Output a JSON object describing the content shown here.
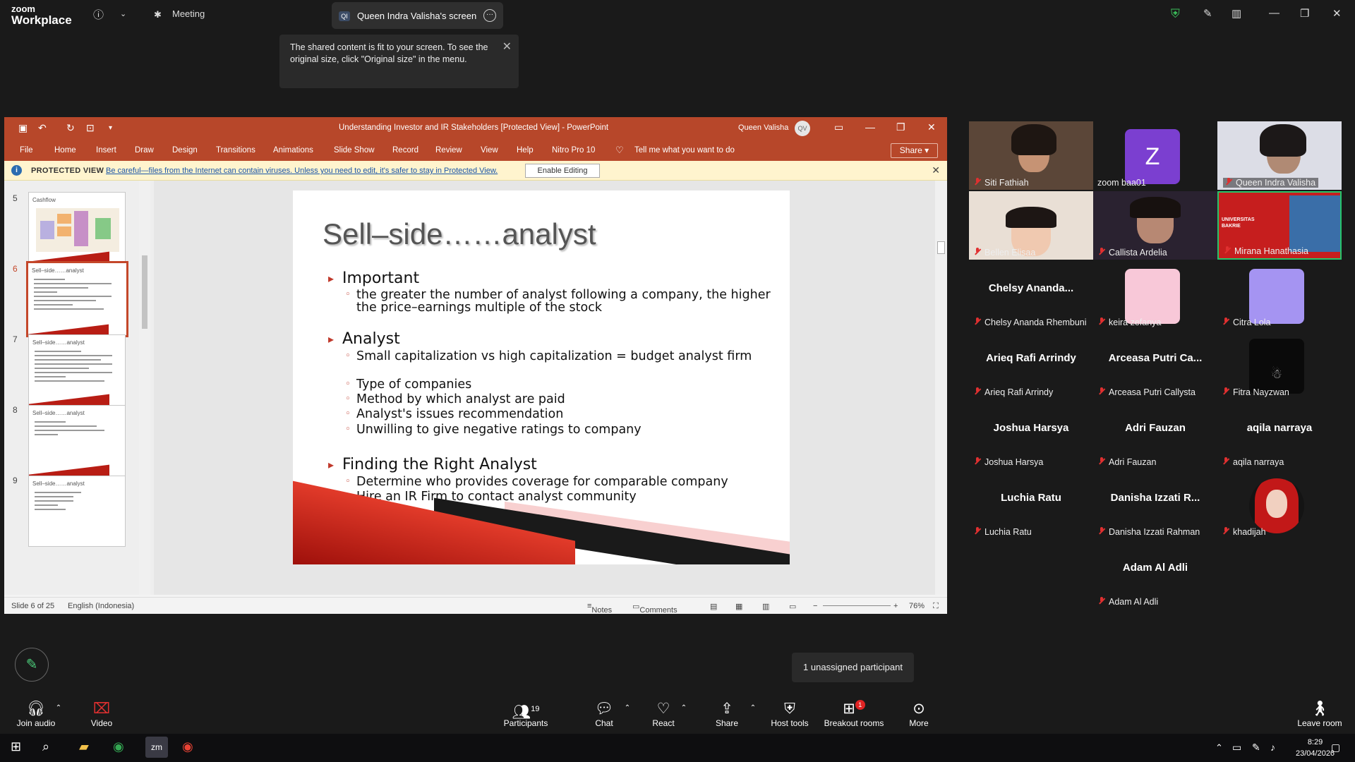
{
  "zoom": {
    "logo_line1": "zoom",
    "logo_line2": "Workplace",
    "meeting_label": "Meeting",
    "screen_tab_initials": "QI",
    "screen_tab_label": "Queen Indra Valisha's screen",
    "tooltip": "The shared content is fit to your screen. To see the original size, click \"Original size\" in the menu.",
    "unassigned": "1 unassigned participant",
    "toolbar": {
      "join_audio": "Join audio",
      "video": "Video",
      "participants": "Participants",
      "participants_count": "19",
      "chat": "Chat",
      "react": "React",
      "share": "Share",
      "host_tools": "Host tools",
      "breakout_rooms": "Breakout rooms",
      "breakout_badge": "1",
      "more": "More",
      "leave_room": "Leave room"
    }
  },
  "ppt": {
    "window_title": "Understanding Investor and IR Stakeholders [Protected View]  -  PowerPoint",
    "user_name": "Queen Valisha",
    "user_initials": "QV",
    "tabs": [
      "File",
      "Home",
      "Insert",
      "Draw",
      "Design",
      "Transitions",
      "Animations",
      "Slide Show",
      "Record",
      "Review",
      "View",
      "Help",
      "Nitro Pro 10"
    ],
    "tell_me": "Tell me what you want to do",
    "share": "Share",
    "protected_label": "PROTECTED VIEW",
    "protected_msg": "Be careful—files from the Internet can contain viruses. Unless you need to edit, it's safer to stay in Protected View.",
    "enable_editing": "Enable Editing",
    "thumbs": [
      {
        "num": "5",
        "title": "Cashflow"
      },
      {
        "num": "6",
        "title": "Sell–side……analyst"
      },
      {
        "num": "7",
        "title": "Sell–side……analyst"
      },
      {
        "num": "8",
        "title": "Sell–side……analyst"
      },
      {
        "num": "9",
        "title": "Sell–side……analyst"
      }
    ],
    "slide": {
      "title": "Sell–side……analyst",
      "h1": "Important",
      "h1_b1": "the greater the number of analyst following a company, the higher the price–earnings multiple of the stock",
      "h2": "Analyst",
      "h2_b1": "Small capitalization vs high capitalization = budget analyst firm",
      "h2_b2": "Type of companies",
      "h2_b3": "Method by which analyst are paid",
      "h2_b4": "Analyst's issues recommendation",
      "h2_b5": "Unwilling to give negative ratings to company",
      "h3": "Finding the Right Analyst",
      "h3_b1": "Determine who provides coverage for comparable company",
      "h3_b2": "Hire an IR Firm to contact analyst community"
    },
    "status": {
      "slide_of": "Slide 6 of 25",
      "language": "English (Indonesia)",
      "notes": "Notes",
      "comments": "Comments",
      "zoom": "76%"
    }
  },
  "participants": [
    {
      "name": "Siti Fathiah"
    },
    {
      "name": "zoom baa01",
      "initial": "Z"
    },
    {
      "name": "Queen Indra Valisha"
    },
    {
      "name": "Bellen Elisaa"
    },
    {
      "name": "Callista Ardelia"
    },
    {
      "name": "Mirana Hanathasia"
    },
    {
      "name": "Chelsy Ananda Rhembuni",
      "display": "Chelsy Ananda..."
    },
    {
      "name": "keira zefanya"
    },
    {
      "name": "Citra Lola"
    },
    {
      "name": "Arieq Rafi Arrindy",
      "display": "Arieq Rafi Arrindy"
    },
    {
      "name": "Arceasa Putri Callysta",
      "display": "Arceasa Putri Ca..."
    },
    {
      "name": "Fitra Nayzwan"
    },
    {
      "name": "Joshua Harsya",
      "display": "Joshua Harsya"
    },
    {
      "name": "Adri Fauzan",
      "display": "Adri Fauzan"
    },
    {
      "name": "aqila narraya",
      "display": "aqila narraya"
    },
    {
      "name": "Luchia Ratu",
      "display": "Luchia Ratu"
    },
    {
      "name": "Danisha Izzati Rahman",
      "display": "Danisha Izzati R..."
    },
    {
      "name": "khadijah"
    },
    {
      "name": "Adam Al Adli",
      "display": "Adam Al Adli"
    }
  ],
  "taskbar": {
    "time": "8:29",
    "date": "23/04/2026"
  }
}
